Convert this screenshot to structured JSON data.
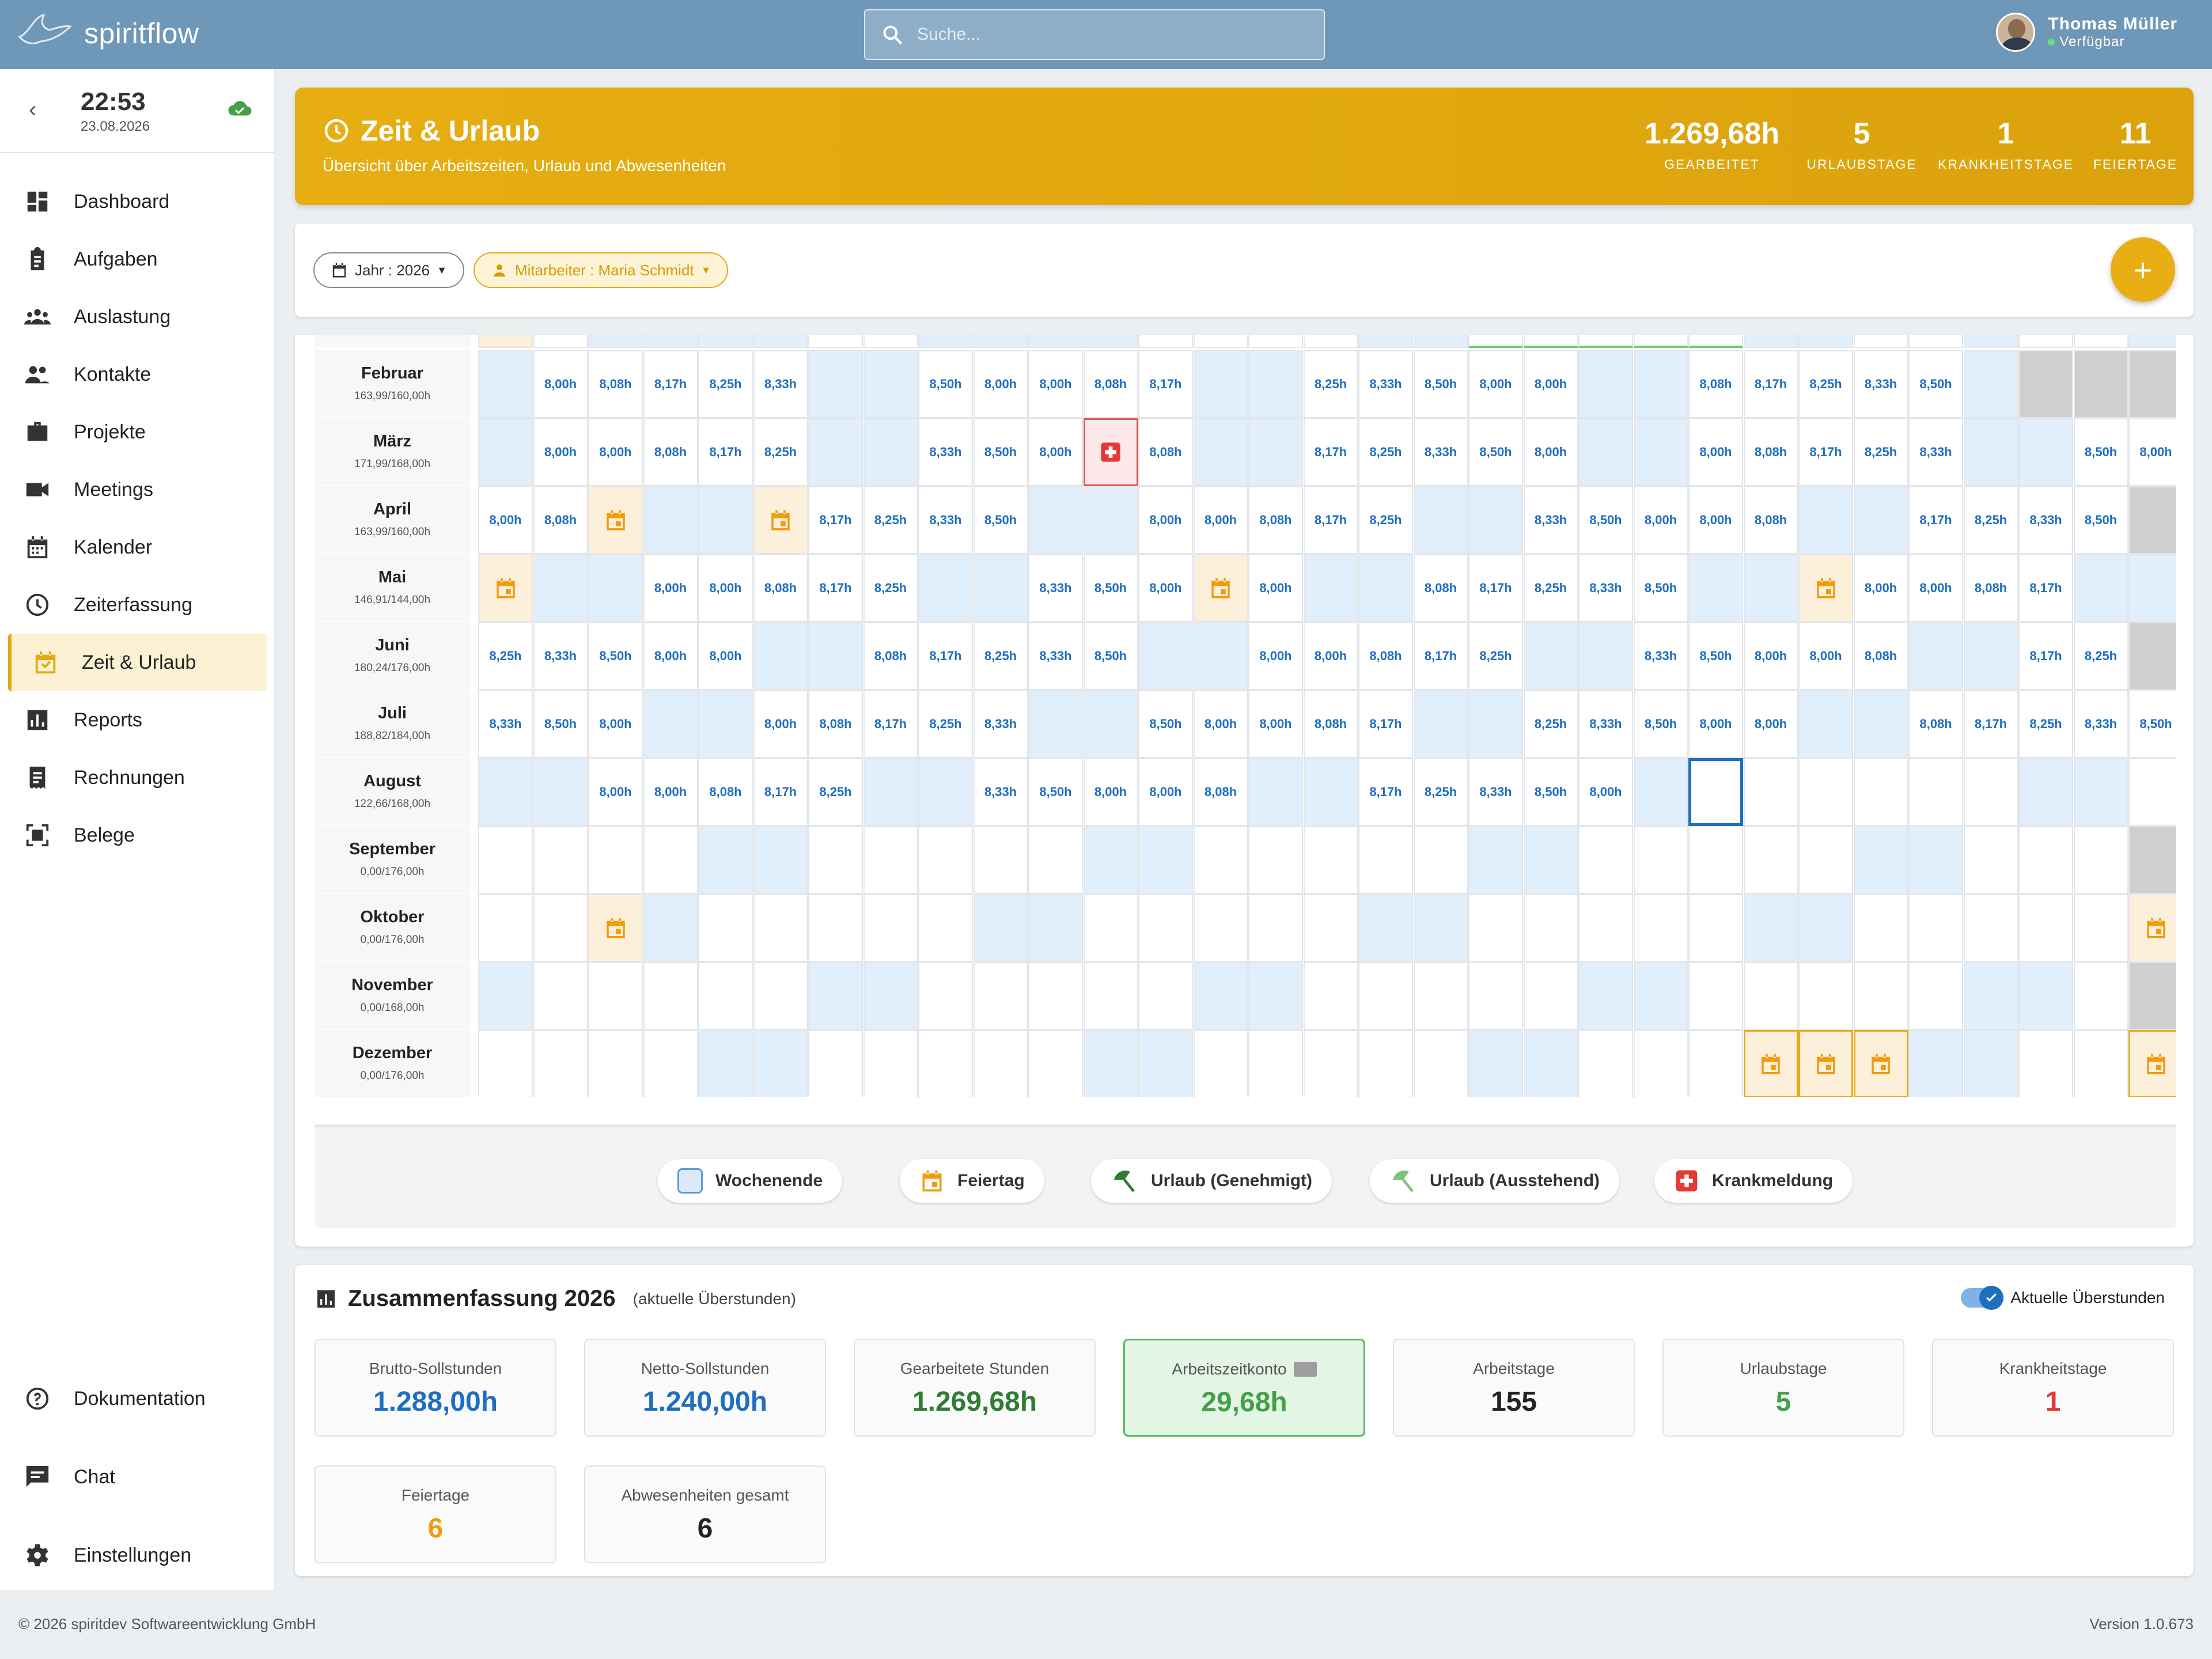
{
  "app": {
    "name": "spiritflow"
  },
  "search": {
    "placeholder": "Suche..."
  },
  "user": {
    "name": "Thomas Müller",
    "status": "Verfügbar"
  },
  "clock": {
    "time": "22:53",
    "date": "23.08.2026"
  },
  "nav": {
    "items": [
      {
        "label": "Dashboard",
        "icon": "dashboard-icon"
      },
      {
        "label": "Aufgaben",
        "icon": "clipboard-icon"
      },
      {
        "label": "Auslastung",
        "icon": "group-icon"
      },
      {
        "label": "Kontakte",
        "icon": "people-icon"
      },
      {
        "label": "Projekte",
        "icon": "briefcase-icon"
      },
      {
        "label": "Meetings",
        "icon": "video-icon"
      },
      {
        "label": "Kalender",
        "icon": "calendar-icon"
      },
      {
        "label": "Zeiterfassung",
        "icon": "clock-icon"
      },
      {
        "label": "Zeit & Urlaub",
        "icon": "event-available-icon"
      },
      {
        "label": "Reports",
        "icon": "chart-icon"
      },
      {
        "label": "Rechnungen",
        "icon": "invoice-icon"
      },
      {
        "label": "Belege",
        "icon": "scan-icon"
      }
    ],
    "bottom": [
      {
        "label": "Dokumentation",
        "icon": "help-icon"
      },
      {
        "label": "Chat",
        "icon": "chat-icon"
      },
      {
        "label": "Einstellungen",
        "icon": "gear-icon"
      }
    ]
  },
  "header": {
    "title": "Zeit & Urlaub",
    "subtitle": "Übersicht über Arbeitszeiten, Urlaub und Abwesenheiten",
    "stats": [
      {
        "value": "1.269,68h",
        "label": "GEARBEITET"
      },
      {
        "value": "5",
        "label": "URLAUBSTAGE"
      },
      {
        "value": "1",
        "label": "KRANKHEITSTAGE"
      },
      {
        "value": "11",
        "label": "FEIERTAGE"
      }
    ]
  },
  "filters": {
    "year": "Jahr : 2026",
    "employee": "Mitarbeiter : Maria Schmidt",
    "add": "+"
  },
  "calendar": {
    "months": [
      {
        "name": "Februar",
        "hours": "163,99/160,00h",
        "cells": [
          "we",
          "8,00h",
          "8,08h",
          "8,17h",
          "8,25h",
          "8,33h",
          "we",
          "we",
          "8,50h",
          "8,00h",
          "8,00h",
          "8,08h",
          "8,17h",
          "we",
          "we",
          "8,25h",
          "8,33h",
          "8,50h",
          "8,00h",
          "8,00h",
          "we",
          "we",
          "8,08h",
          "8,17h",
          "8,25h",
          "8,33h",
          "8,50h",
          "we",
          "gr",
          "gr",
          "gr"
        ]
      },
      {
        "name": "März",
        "hours": "171,99/168,00h",
        "cells": [
          "we",
          "8,00h",
          "8,00h",
          "8,08h",
          "8,17h",
          "8,25h",
          "we",
          "we",
          "8,33h",
          "8,50h",
          "8,00h",
          "sick",
          "8,08h",
          "we",
          "we",
          "8,17h",
          "8,25h",
          "8,33h",
          "8,50h",
          "8,00h",
          "we",
          "we",
          "8,00h",
          "8,08h",
          "8,17h",
          "8,25h",
          "8,33h",
          "we",
          "we",
          "8,50h",
          "8,00h"
        ]
      },
      {
        "name": "April",
        "hours": "163,99/160,00h",
        "cells": [
          "8,00h",
          "8,08h",
          "hol",
          "we",
          "we",
          "hol",
          "8,17h",
          "8,25h",
          "8,33h",
          "8,50h",
          "we",
          "we",
          "8,00h",
          "8,00h",
          "8,08h",
          "8,17h",
          "8,25h",
          "we",
          "we",
          "8,33h",
          "8,50h",
          "8,00h",
          "8,00h",
          "8,08h",
          "we",
          "we",
          "8,17h",
          "8,25h",
          "8,33h",
          "8,50h",
          "gr"
        ]
      },
      {
        "name": "Mai",
        "hours": "146,91/144,00h",
        "cells": [
          "hol",
          "we",
          "we",
          "8,00h",
          "8,00h",
          "8,08h",
          "8,17h",
          "8,25h",
          "we",
          "we",
          "8,33h",
          "8,50h",
          "8,00h",
          "hol",
          "8,00h",
          "we",
          "we",
          "8,08h",
          "8,17h",
          "8,25h",
          "8,33h",
          "8,50h",
          "we",
          "we",
          "hol",
          "8,00h",
          "8,00h",
          "8,08h",
          "8,17h",
          "we",
          "we"
        ]
      },
      {
        "name": "Juni",
        "hours": "180,24/176,00h",
        "cells": [
          "8,25h",
          "8,33h",
          "8,50h",
          "8,00h",
          "8,00h",
          "we",
          "we",
          "8,08h",
          "8,17h",
          "8,25h",
          "8,33h",
          "8,50h",
          "we",
          "we",
          "8,00h",
          "8,00h",
          "8,08h",
          "8,17h",
          "8,25h",
          "we",
          "we",
          "8,33h",
          "8,50h",
          "8,00h",
          "8,00h",
          "8,08h",
          "we",
          "we",
          "8,17h",
          "8,25h",
          "gr"
        ]
      },
      {
        "name": "Juli",
        "hours": "188,82/184,00h",
        "cells": [
          "8,33h",
          "8,50h",
          "8,00h",
          "we",
          "we",
          "8,00h",
          "8,08h",
          "8,17h",
          "8,25h",
          "8,33h",
          "we",
          "we",
          "8,50h",
          "8,00h",
          "8,00h",
          "8,08h",
          "8,17h",
          "we",
          "we",
          "8,25h",
          "8,33h",
          "8,50h",
          "8,00h",
          "8,00h",
          "we",
          "we",
          "8,08h",
          "8,17h",
          "8,25h",
          "8,33h",
          "8,50h"
        ]
      },
      {
        "name": "August",
        "hours": "122,66/168,00h",
        "cells": [
          "we",
          "we",
          "8,00h",
          "8,00h",
          "8,08h",
          "8,17h",
          "8,25h",
          "we",
          "we",
          "8,33h",
          "8,50h",
          "8,00h",
          "8,00h",
          "8,08h",
          "we",
          "we",
          "8,17h",
          "8,25h",
          "8,33h",
          "8,50h",
          "8,00h",
          "we",
          "sel",
          "",
          "",
          "",
          "",
          "",
          "we",
          "we",
          ""
        ]
      },
      {
        "name": "September",
        "hours": "0,00/176,00h",
        "cells": [
          "",
          "",
          "",
          "",
          "we",
          "we",
          "",
          "",
          "",
          "",
          "",
          "we",
          "we",
          "",
          "",
          "",
          "",
          "",
          "we",
          "we",
          "",
          "",
          "",
          "",
          "",
          "we",
          "we",
          "",
          "",
          "",
          "gr"
        ]
      },
      {
        "name": "Oktober",
        "hours": "0,00/176,00h",
        "cells": [
          "",
          "",
          "hol",
          "we",
          "",
          "",
          "",
          "",
          "",
          "we",
          "we",
          "",
          "",
          "",
          "",
          "",
          "we",
          "we",
          "",
          "",
          "",
          "",
          "",
          "we",
          "we",
          "",
          "",
          "",
          "",
          "",
          "holc"
        ]
      },
      {
        "name": "November",
        "hours": "0,00/168,00h",
        "cells": [
          "we",
          "",
          "",
          "",
          "",
          "",
          "we",
          "we",
          "",
          "",
          "",
          "",
          "",
          "we",
          "we",
          "",
          "",
          "",
          "",
          "",
          "we",
          "we",
          "",
          "",
          "",
          "",
          "",
          "we",
          "we",
          "",
          "gr"
        ]
      },
      {
        "name": "Dezember",
        "hours": "0,00/176,00h",
        "cells": [
          "",
          "",
          "",
          "",
          "we",
          "we",
          "",
          "",
          "",
          "",
          "",
          "we",
          "we",
          "",
          "",
          "",
          "",
          "",
          "we",
          "we",
          "",
          "",
          "",
          "holb",
          "holb",
          "holb",
          "we",
          "we",
          "",
          "",
          "holb"
        ]
      }
    ]
  },
  "legend": [
    {
      "label": "Wochenende",
      "icon": "weekend-square-icon"
    },
    {
      "label": "Feiertag",
      "icon": "holiday-calendar-icon"
    },
    {
      "label": "Urlaub (Genehmigt)",
      "icon": "umbrella-approved-icon"
    },
    {
      "label": "Urlaub (Ausstehend)",
      "icon": "umbrella-pending-icon"
    },
    {
      "label": "Krankmeldung",
      "icon": "medical-cross-icon"
    }
  ],
  "summary": {
    "title": "Zusammenfassung 2026",
    "note": "(aktuelle Überstunden)",
    "toggle_label": "Aktuelle Überstunden",
    "cards": [
      {
        "label": "Brutto-Sollstunden",
        "value": "1.288,00h",
        "color": "#1f6fbf"
      },
      {
        "label": "Netto-Sollstunden",
        "value": "1.240,00h",
        "color": "#1f6fbf"
      },
      {
        "label": "Gearbeitete Stunden",
        "value": "1.269,68h",
        "color": "#2e7d32"
      },
      {
        "label": "Arbeitszeitkonto",
        "value": "29,68h",
        "color": "#43a047"
      },
      {
        "label": "Arbeitstage",
        "value": "155",
        "color": "#222222"
      },
      {
        "label": "Urlaubstage",
        "value": "5",
        "color": "#43a047"
      },
      {
        "label": "Krankheitstage",
        "value": "1",
        "color": "#e53935"
      },
      {
        "label": "Feiertage",
        "value": "6",
        "color": "#f29b0c"
      },
      {
        "label": "Abwesenheiten gesamt",
        "value": "6",
        "color": "#222222"
      }
    ]
  },
  "footer": {
    "copyright": "© 2026 spiritdev Softwareentwicklung GmbH",
    "version": "Version 1.0.673"
  }
}
